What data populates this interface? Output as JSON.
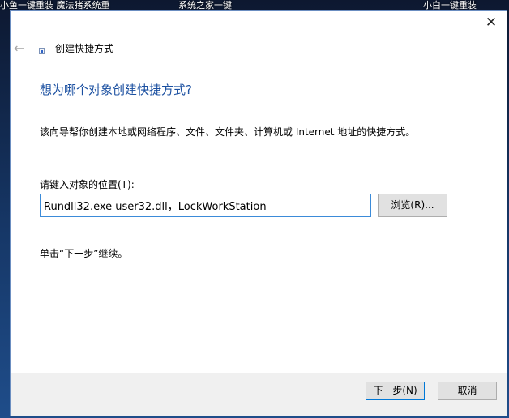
{
  "desktop": {
    "captions": [
      "小鱼一键重装 魔法猪系统重",
      "系统之家一键",
      "小白一键重装"
    ]
  },
  "wizard": {
    "title": "创建快捷方式",
    "heading": "想为哪个对象创建快捷方式?",
    "description": "该向导帮你创建本地或网络程序、文件、文件夹、计算机或 Internet 地址的快捷方式。",
    "location_label": "请键入对象的位置(T):",
    "location_value": "Rundll32.exe user32.dll，LockWorkStation",
    "browse_label": "浏览(R)...",
    "hint": "单击“下一步”继续。",
    "next_label": "下一步(N)",
    "cancel_label": "取消"
  },
  "icons": {
    "close": "close-icon",
    "back": "back-arrow-icon",
    "wizard": "shortcut-wizard-icon"
  },
  "colors": {
    "heading": "#1a4fa0",
    "input_border": "#3b8bd9",
    "default_button_border": "#0078d7"
  }
}
